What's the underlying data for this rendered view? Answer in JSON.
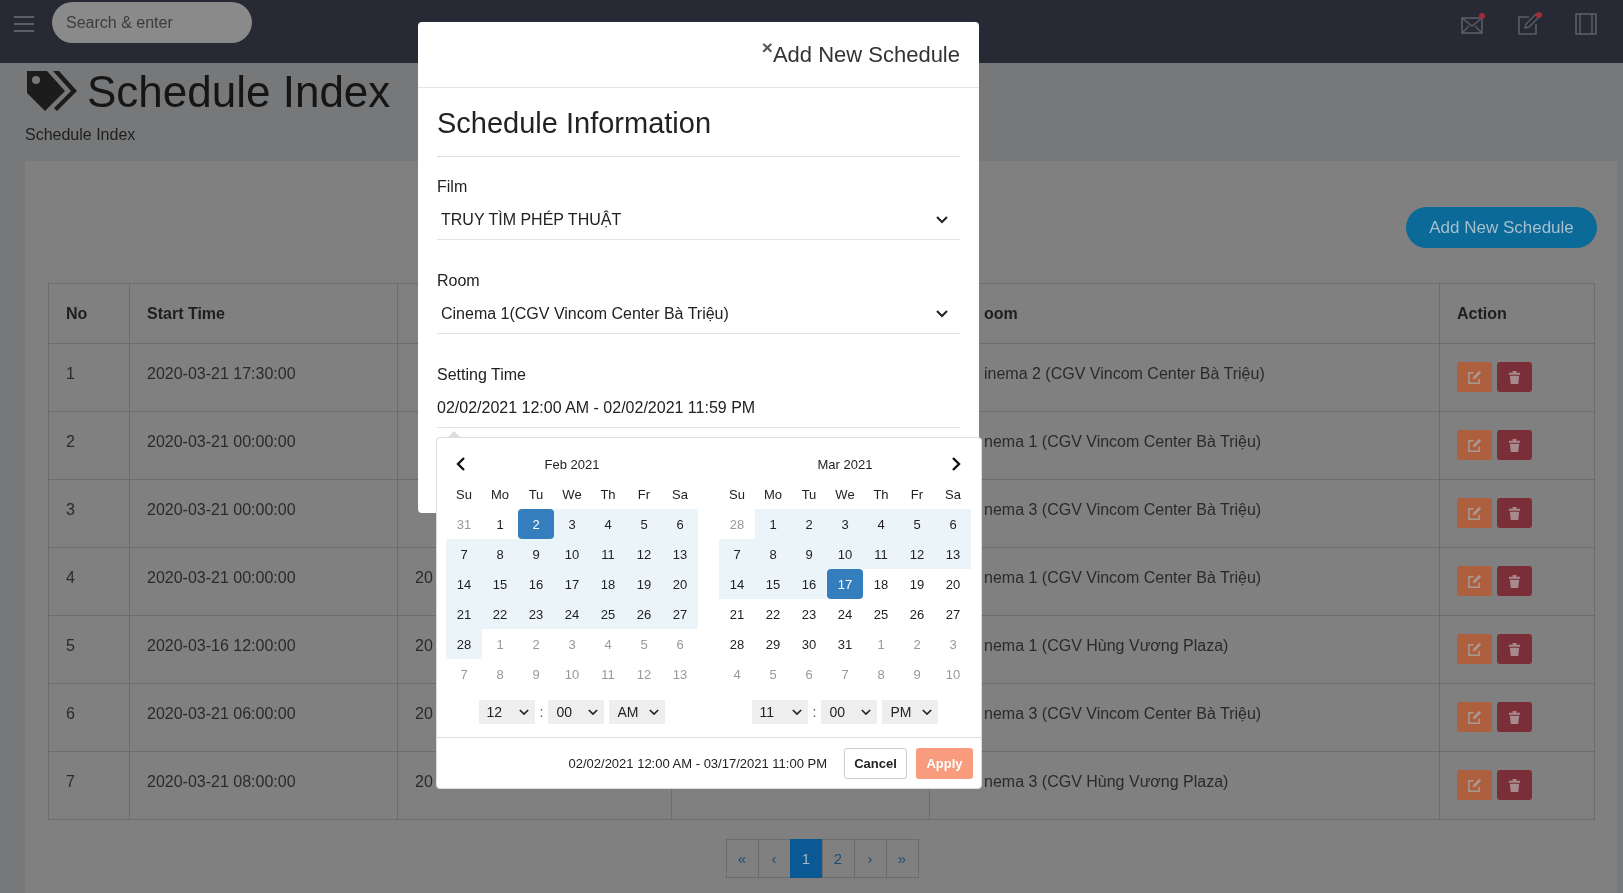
{
  "top_bar": {
    "search": {
      "placeholder": "Search & enter"
    }
  },
  "page": {
    "title": "Schedule Index",
    "breadcrumb": "Schedule Index",
    "add_button": "Add New Schedule"
  },
  "table": {
    "columns": [
      "No",
      "Start Time",
      "oom",
      "Action"
    ],
    "rows": [
      {
        "no": "1",
        "start_time": "2020-03-21 17:30:00",
        "room": "inema 2 (CGV Vincom Center Bà Triệu)"
      },
      {
        "no": "2",
        "start_time": "2020-03-21 00:00:00",
        "room": "nema 1 (CGV Vincom Center Bà Triệu)"
      },
      {
        "no": "3",
        "start_time": "2020-03-21 00:00:00",
        "room": "nema 3 (CGV Vincom Center Bà Triệu)"
      },
      {
        "no": "4",
        "start_time": "2020-03-21 00:00:00",
        "column_3": "20",
        "room": "nema 1 (CGV Vincom Center Bà Triệu)"
      },
      {
        "no": "5",
        "start_time": "2020-03-16 12:00:00",
        "column_3": "20",
        "room": "nema 1 (CGV Hùng Vương Plaza)"
      },
      {
        "no": "6",
        "start_time": "2020-03-21 06:00:00",
        "column_3": "20",
        "room": "nema 3 (CGV Vincom Center Bà Triệu)"
      },
      {
        "no": "7",
        "start_time": "2020-03-21 08:00:00",
        "column_3": "20",
        "room": "nema 3 (CGV Hùng Vương Plaza)"
      }
    ]
  },
  "pagination": [
    {
      "label": "«",
      "selected": false
    },
    {
      "label": "‹",
      "selected": false
    },
    {
      "label": "1",
      "selected": true
    },
    {
      "label": "2",
      "selected": false
    },
    {
      "label": "›",
      "selected": false
    },
    {
      "label": "»",
      "selected": false
    }
  ],
  "modal": {
    "close": "×",
    "title": "Add New Schedule",
    "section": "Schedule Information",
    "fields": [
      {
        "label": "Film",
        "value": "TRUY TÌM PHÉP THUẬT",
        "kind": "select"
      },
      {
        "label": "Room",
        "value": "Cinema 1(CGV Vincom Center Bà Triệu)",
        "kind": "select"
      },
      {
        "label": "Setting Time",
        "value": "02/02/2021 12:00 AM - 02/02/2021 11:59 PM",
        "kind": "input"
      }
    ]
  },
  "date_picker": {
    "calendars": [
      {
        "month": "Feb 2021",
        "weekdays": [
          "Su",
          "Mo",
          "Tu",
          "We",
          "Th",
          "Fr",
          "Sa"
        ],
        "weeks": [
          [
            {
              "d": "31",
              "off": true,
              "in_range": false,
              "selected": false
            },
            {
              "d": "1",
              "off": false,
              "in_range": false,
              "selected": false
            },
            {
              "d": "2",
              "off": false,
              "in_range": false,
              "selected": true
            },
            {
              "d": "3",
              "off": false,
              "in_range": true,
              "selected": false
            },
            {
              "d": "4",
              "off": false,
              "in_range": true,
              "selected": false
            },
            {
              "d": "5",
              "off": false,
              "in_range": true,
              "selected": false
            },
            {
              "d": "6",
              "off": false,
              "in_range": true,
              "selected": false
            }
          ],
          [
            {
              "d": "7",
              "off": false,
              "in_range": true,
              "selected": false
            },
            {
              "d": "8",
              "off": false,
              "in_range": true,
              "selected": false
            },
            {
              "d": "9",
              "off": false,
              "in_range": true,
              "selected": false
            },
            {
              "d": "10",
              "off": false,
              "in_range": true,
              "selected": false
            },
            {
              "d": "11",
              "off": false,
              "in_range": true,
              "selected": false
            },
            {
              "d": "12",
              "off": false,
              "in_range": true,
              "selected": false
            },
            {
              "d": "13",
              "off": false,
              "in_range": true,
              "selected": false
            }
          ],
          [
            {
              "d": "14",
              "off": false,
              "in_range": true,
              "selected": false
            },
            {
              "d": "15",
              "off": false,
              "in_range": true,
              "selected": false
            },
            {
              "d": "16",
              "off": false,
              "in_range": true,
              "selected": false
            },
            {
              "d": "17",
              "off": false,
              "in_range": true,
              "selected": false
            },
            {
              "d": "18",
              "off": false,
              "in_range": true,
              "selected": false
            },
            {
              "d": "19",
              "off": false,
              "in_range": true,
              "selected": false
            },
            {
              "d": "20",
              "off": false,
              "in_range": true,
              "selected": false
            }
          ],
          [
            {
              "d": "21",
              "off": false,
              "in_range": true,
              "selected": false
            },
            {
              "d": "22",
              "off": false,
              "in_range": true,
              "selected": false
            },
            {
              "d": "23",
              "off": false,
              "in_range": true,
              "selected": false
            },
            {
              "d": "24",
              "off": false,
              "in_range": true,
              "selected": false
            },
            {
              "d": "25",
              "off": false,
              "in_range": true,
              "selected": false
            },
            {
              "d": "26",
              "off": false,
              "in_range": true,
              "selected": false
            },
            {
              "d": "27",
              "off": false,
              "in_range": true,
              "selected": false
            }
          ],
          [
            {
              "d": "28",
              "off": false,
              "in_range": true,
              "selected": false
            },
            {
              "d": "1",
              "off": true,
              "in_range": false,
              "selected": false
            },
            {
              "d": "2",
              "off": true,
              "in_range": false,
              "selected": false
            },
            {
              "d": "3",
              "off": true,
              "in_range": false,
              "selected": false
            },
            {
              "d": "4",
              "off": true,
              "in_range": false,
              "selected": false
            },
            {
              "d": "5",
              "off": true,
              "in_range": false,
              "selected": false
            },
            {
              "d": "6",
              "off": true,
              "in_range": false,
              "selected": false
            }
          ],
          [
            {
              "d": "7",
              "off": true,
              "in_range": false,
              "selected": false
            },
            {
              "d": "8",
              "off": true,
              "in_range": false,
              "selected": false
            },
            {
              "d": "9",
              "off": true,
              "in_range": false,
              "selected": false
            },
            {
              "d": "10",
              "off": true,
              "in_range": false,
              "selected": false
            },
            {
              "d": "11",
              "off": true,
              "in_range": false,
              "selected": false
            },
            {
              "d": "12",
              "off": true,
              "in_range": false,
              "selected": false
            },
            {
              "d": "13",
              "off": true,
              "in_range": false,
              "selected": false
            }
          ]
        ],
        "time": {
          "hour": "12",
          "separator": ":",
          "minute": "00",
          "period": "AM"
        }
      },
      {
        "month": "Mar 2021",
        "weekdays": [
          "Su",
          "Mo",
          "Tu",
          "We",
          "Th",
          "Fr",
          "Sa"
        ],
        "weeks": [
          [
            {
              "d": "28",
              "off": true,
              "in_range": false,
              "selected": false
            },
            {
              "d": "1",
              "off": false,
              "in_range": true,
              "selected": false
            },
            {
              "d": "2",
              "off": false,
              "in_range": true,
              "selected": false
            },
            {
              "d": "3",
              "off": false,
              "in_range": true,
              "selected": false
            },
            {
              "d": "4",
              "off": false,
              "in_range": true,
              "selected": false
            },
            {
              "d": "5",
              "off": false,
              "in_range": true,
              "selected": false
            },
            {
              "d": "6",
              "off": false,
              "in_range": true,
              "selected": false
            }
          ],
          [
            {
              "d": "7",
              "off": false,
              "in_range": true,
              "selected": false
            },
            {
              "d": "8",
              "off": false,
              "in_range": true,
              "selected": false
            },
            {
              "d": "9",
              "off": false,
              "in_range": true,
              "selected": false
            },
            {
              "d": "10",
              "off": false,
              "in_range": true,
              "selected": false
            },
            {
              "d": "11",
              "off": false,
              "in_range": true,
              "selected": false
            },
            {
              "d": "12",
              "off": false,
              "in_range": true,
              "selected": false
            },
            {
              "d": "13",
              "off": false,
              "in_range": true,
              "selected": false
            }
          ],
          [
            {
              "d": "14",
              "off": false,
              "in_range": true,
              "selected": false
            },
            {
              "d": "15",
              "off": false,
              "in_range": true,
              "selected": false
            },
            {
              "d": "16",
              "off": false,
              "in_range": true,
              "selected": false
            },
            {
              "d": "17",
              "off": false,
              "in_range": false,
              "selected": true
            },
            {
              "d": "18",
              "off": false,
              "in_range": false,
              "selected": false
            },
            {
              "d": "19",
              "off": false,
              "in_range": false,
              "selected": false
            },
            {
              "d": "20",
              "off": false,
              "in_range": false,
              "selected": false
            }
          ],
          [
            {
              "d": "21",
              "off": false,
              "in_range": false,
              "selected": false
            },
            {
              "d": "22",
              "off": false,
              "in_range": false,
              "selected": false
            },
            {
              "d": "23",
              "off": false,
              "in_range": false,
              "selected": false
            },
            {
              "d": "24",
              "off": false,
              "in_range": false,
              "selected": false
            },
            {
              "d": "25",
              "off": false,
              "in_range": false,
              "selected": false
            },
            {
              "d": "26",
              "off": false,
              "in_range": false,
              "selected": false
            },
            {
              "d": "27",
              "off": false,
              "in_range": false,
              "selected": false
            }
          ],
          [
            {
              "d": "28",
              "off": false,
              "in_range": false,
              "selected": false
            },
            {
              "d": "29",
              "off": false,
              "in_range": false,
              "selected": false
            },
            {
              "d": "30",
              "off": false,
              "in_range": false,
              "selected": false
            },
            {
              "d": "31",
              "off": false,
              "in_range": false,
              "selected": false
            },
            {
              "d": "1",
              "off": true,
              "in_range": false,
              "selected": false
            },
            {
              "d": "2",
              "off": true,
              "in_range": false,
              "selected": false
            },
            {
              "d": "3",
              "off": true,
              "in_range": false,
              "selected": false
            }
          ],
          [
            {
              "d": "4",
              "off": true,
              "in_range": false,
              "selected": false
            },
            {
              "d": "5",
              "off": true,
              "in_range": false,
              "selected": false
            },
            {
              "d": "6",
              "off": true,
              "in_range": false,
              "selected": false
            },
            {
              "d": "7",
              "off": true,
              "in_range": false,
              "selected": false
            },
            {
              "d": "8",
              "off": true,
              "in_range": false,
              "selected": false
            },
            {
              "d": "9",
              "off": true,
              "in_range": false,
              "selected": false
            },
            {
              "d": "10",
              "off": true,
              "in_range": false,
              "selected": false
            }
          ]
        ],
        "time": {
          "hour": "11",
          "separator": ":",
          "minute": "00",
          "period": "PM"
        }
      }
    ],
    "range_text": "02/02/2021 12:00 AM - 03/17/2021 11:00 PM",
    "cancel": "Cancel",
    "apply": "Apply"
  }
}
